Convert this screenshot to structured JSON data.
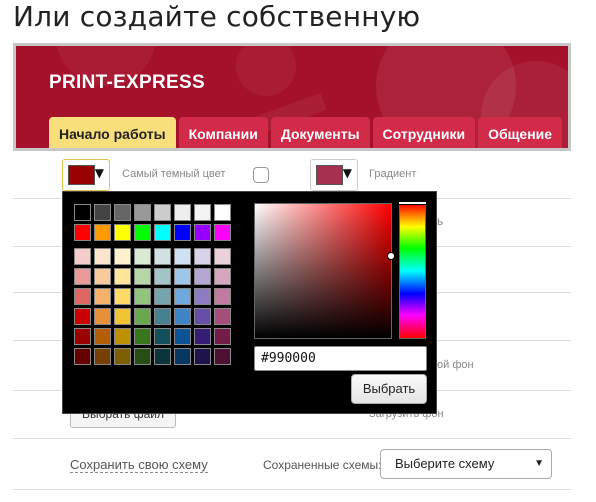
{
  "page": {
    "title": "Или создайте собственную"
  },
  "preview": {
    "brand": "PRINT-EXPRESS",
    "colors": {
      "background": "#a5102a",
      "tab": "#d22a49",
      "active_tab": "#f9de7c"
    },
    "tabs": [
      {
        "label": "Начало работы",
        "active": true
      },
      {
        "label": "Компании",
        "active": false
      },
      {
        "label": "Документы",
        "active": false
      },
      {
        "label": "Сотрудники",
        "active": false
      },
      {
        "label": "Общение",
        "active": false
      }
    ]
  },
  "settings": {
    "darkest_color": {
      "label": "Самый темный цвет",
      "value": "#990000",
      "icon": "dropdown-arrow-icon"
    },
    "gradient": {
      "label": "Градиент",
      "checked": false,
      "value": "#a8304f",
      "icon": "dropdown-arrow-icon"
    },
    "partial_label_1": "ь",
    "partial_label_2": "ой фон",
    "upload_button": "Выбрать файл",
    "upload_label": "Загрузить фон",
    "save_scheme_link": "Сохранить свою схему",
    "saved_schemes_label": "Сохраненные схемы:",
    "saved_schemes_select": "Выберите схему",
    "select_arrow_icon": "caret-down-icon"
  },
  "picker": {
    "hex_value": "#990000",
    "choose_button": "Выбрать",
    "palette": [
      [
        "#000000",
        "#444444",
        "#666666",
        "#999999",
        "#cccccc",
        "#eeeeee",
        "#f3f3f3",
        "#ffffff"
      ],
      [
        "#ff0000",
        "#ff9900",
        "#ffff00",
        "#00ff00",
        "#00ffff",
        "#0000ff",
        "#9900ff",
        "#ff00ff"
      ],
      [
        "#f4cccc",
        "#fce5cd",
        "#fff2cc",
        "#d9ead3",
        "#d0e0e3",
        "#cfe2f3",
        "#d9d2e9",
        "#ead1dc"
      ],
      [
        "#ea9999",
        "#f9cb9c",
        "#ffe599",
        "#b6d7a8",
        "#a2c4c9",
        "#9fc5e8",
        "#b4a7d6",
        "#d5a6bd"
      ],
      [
        "#e06666",
        "#f6b26b",
        "#ffd966",
        "#93c47d",
        "#76a5af",
        "#6fa8dc",
        "#8e7cc3",
        "#c27ba0"
      ],
      [
        "#cc0000",
        "#e69138",
        "#f1c232",
        "#6aa84f",
        "#45818e",
        "#3d85c6",
        "#674ea7",
        "#a64d79"
      ],
      [
        "#990000",
        "#b45f06",
        "#bf9000",
        "#38761d",
        "#134f5c",
        "#0b5394",
        "#351c75",
        "#741b47"
      ],
      [
        "#660000",
        "#783f04",
        "#7f6000",
        "#274e13",
        "#0c343d",
        "#073763",
        "#20124d",
        "#4c1130"
      ]
    ]
  }
}
